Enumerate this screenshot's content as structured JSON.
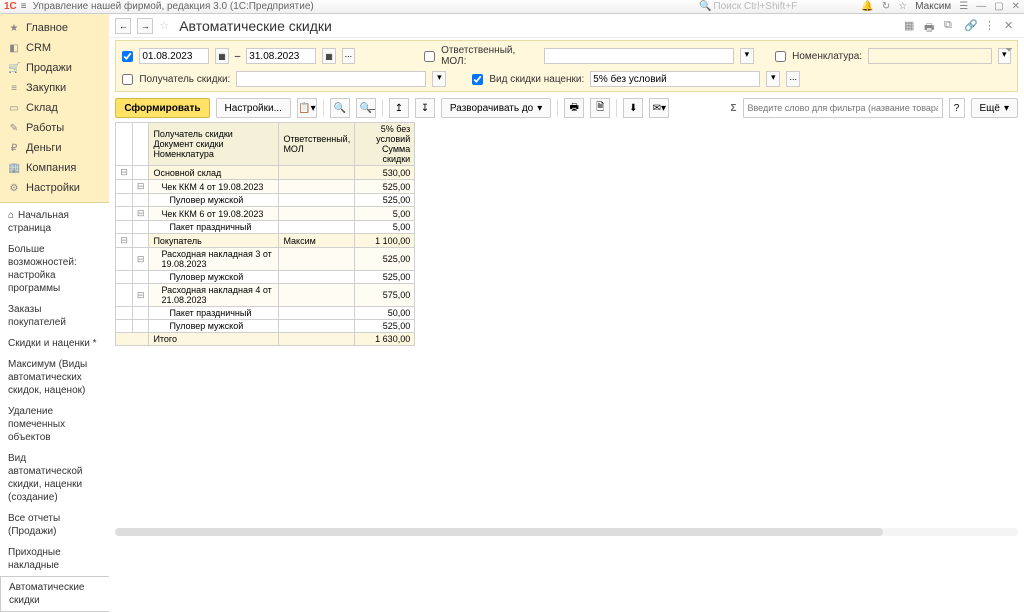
{
  "app": {
    "title": "Управление нашей фирмой, редакция 3.0  (1С:Предприятие)",
    "search_placeholder": "Поиск  Ctrl+Shift+F",
    "user": "Максим"
  },
  "sidebar": {
    "items": [
      {
        "icon": "★",
        "label": "Главное"
      },
      {
        "icon": "◧",
        "label": "CRM"
      },
      {
        "icon": "🛒",
        "label": "Продажи"
      },
      {
        "icon": "≡",
        "label": "Закупки"
      },
      {
        "icon": "▭",
        "label": "Склад"
      },
      {
        "icon": "✎",
        "label": "Работы"
      },
      {
        "icon": "₽",
        "label": "Деньги"
      },
      {
        "icon": "🏢",
        "label": "Компания"
      },
      {
        "icon": "⚙",
        "label": "Настройки"
      }
    ],
    "sub": [
      "Начальная страница",
      "Больше возможностей: настройка программы",
      "Заказы покупателей",
      "Скидки и наценки *",
      "Максимум (Виды автоматических скидок, наценок)",
      "Удаление помеченных объектов",
      "Вид автоматической скидки, наценки (создание)",
      "Все отчеты (Продажи)",
      "Приходные накладные",
      "Автоматические скидки"
    ]
  },
  "page": {
    "title": "Автоматические скидки"
  },
  "filters": {
    "date_from": "01.08.2023",
    "date_to": "31.08.2023",
    "dash": "–",
    "dots": "...",
    "responsible_label": "Ответственный, МОЛ:",
    "nomenclature_label": "Номенклатура:",
    "recipient_label": "Получатель скидки:",
    "discount_type_label": "Вид скидки наценки:",
    "discount_type_value": "5% без условий"
  },
  "toolbar": {
    "form_label": "Сформировать",
    "settings_label": "Настройки...",
    "expand_label": "Разворачивать до",
    "filter_placeholder": "Введите слово для фильтра (название товара, покупателя и пр.)",
    "more_label": "Ещё"
  },
  "report": {
    "headers": {
      "c1a": "Получатель скидки",
      "c1b": "Документ скидки",
      "c1c": "Номенклатура",
      "c2": "Ответственный, МОЛ",
      "c3": "5% без условий",
      "c3b": "Сумма скидки"
    },
    "rows": [
      {
        "type": "g1",
        "tree": "⊟",
        "c1": "Основной склад",
        "c2": "",
        "c3": "530,00"
      },
      {
        "type": "g2",
        "tree": "⊟",
        "c1": "Чек ККМ 4 от 19.08.2023",
        "c2": "",
        "c3": "525,00"
      },
      {
        "type": "leaf",
        "c1": "Пуловер мужской",
        "c2": "",
        "c3": "525,00"
      },
      {
        "type": "g2",
        "tree": "⊟",
        "c1": "Чек ККМ 6 от 19.08.2023",
        "c2": "",
        "c3": "5,00"
      },
      {
        "type": "leaf",
        "c1": "Пакет праздничный",
        "c2": "",
        "c3": "5,00"
      },
      {
        "type": "g1",
        "tree": "⊟",
        "c1": "Покупатель",
        "c2": "Максим",
        "c3": "1 100,00"
      },
      {
        "type": "g2",
        "tree": "⊟",
        "c1": "Расходная накладная 3 от 19.08.2023",
        "c2": "",
        "c3": "525,00"
      },
      {
        "type": "leaf",
        "c1": "Пуловер мужской",
        "c2": "",
        "c3": "525,00"
      },
      {
        "type": "g2",
        "tree": "⊟",
        "c1": "Расходная накладная 4 от 21.08.2023",
        "c2": "",
        "c3": "575,00"
      },
      {
        "type": "leaf",
        "c1": "Пакет праздничный",
        "c2": "",
        "c3": "50,00"
      },
      {
        "type": "leaf",
        "c1": "Пуловер мужской",
        "c2": "",
        "c3": "525,00"
      }
    ],
    "total_label": "Итого",
    "total_value": "1 630,00"
  }
}
